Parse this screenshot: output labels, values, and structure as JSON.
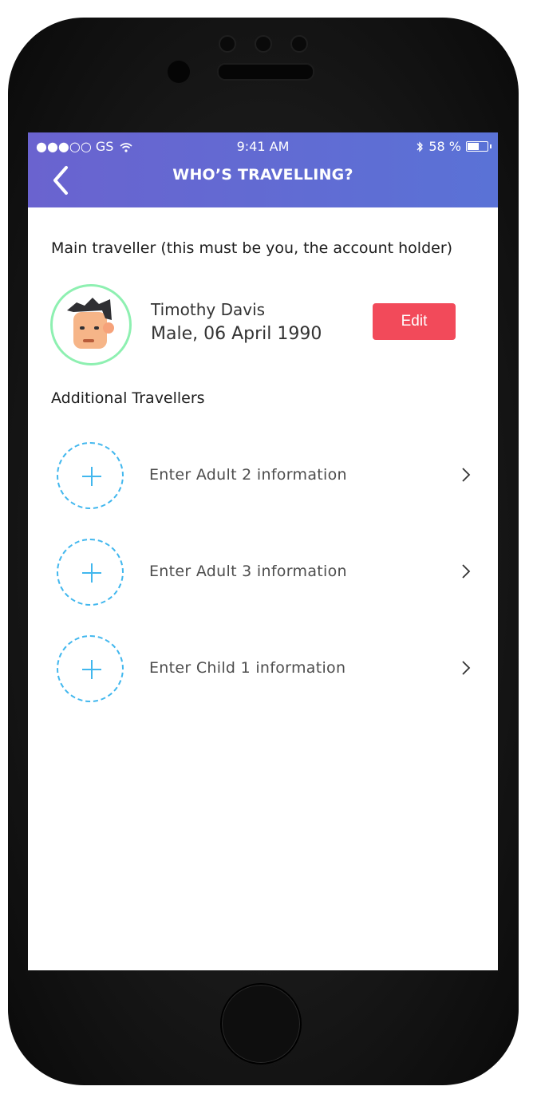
{
  "status_bar": {
    "carrier": "●●●○○ GS",
    "time": "9:41 AM",
    "battery": "58 %",
    "battery_level": 0.58
  },
  "header": {
    "title": "WHO’S TRAVELLING?"
  },
  "main_traveller": {
    "section_label": "Main traveller (this must be you, the account holder)",
    "name": "Timothy Davis",
    "details": "Male, 06 April 1990",
    "edit_label": "Edit"
  },
  "additional": {
    "section_label": "Additional Travellers",
    "rows": [
      {
        "label": "Enter Adult 2 information"
      },
      {
        "label": "Enter Adult 3 information"
      },
      {
        "label": "Enter Child 1 information"
      }
    ]
  },
  "colors": {
    "header_start": "#6a63cf",
    "header_end": "#5a72d6",
    "edit_button": "#f24a5a",
    "avatar_ring": "#8ef0b1",
    "dashed_circle": "#41b7ee"
  },
  "icons": [
    "back-chevron-icon",
    "wifi-icon",
    "bluetooth-icon",
    "battery-icon",
    "plus-icon",
    "chevron-right-icon"
  ]
}
